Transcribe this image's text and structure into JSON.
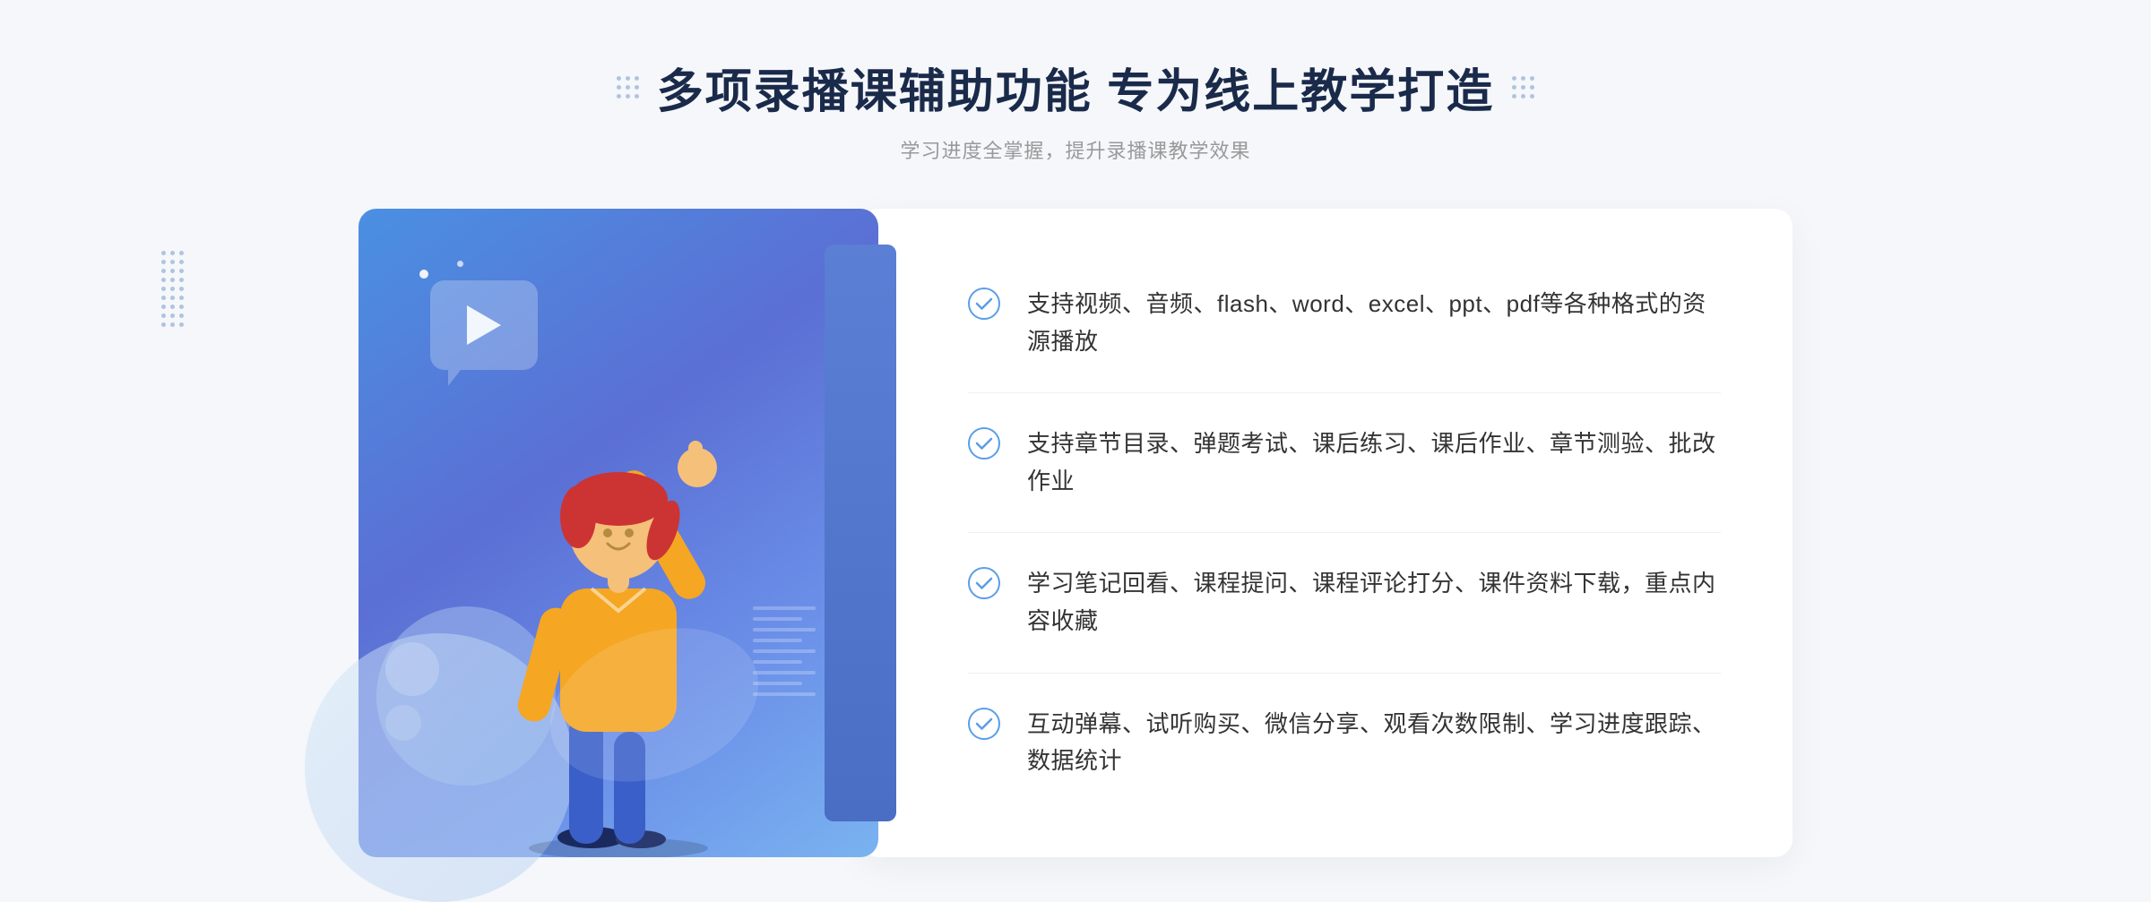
{
  "header": {
    "main_title": "多项录播课辅助功能 专为线上教学打造",
    "subtitle": "学习进度全掌握，提升录播课教学效果"
  },
  "features": [
    {
      "id": "feature-1",
      "text": "支持视频、音频、flash、word、excel、ppt、pdf等各种格式的资源播放"
    },
    {
      "id": "feature-2",
      "text": "支持章节目录、弹题考试、课后练习、课后作业、章节测验、批改作业"
    },
    {
      "id": "feature-3",
      "text": "学习笔记回看、课程提问、课程评论打分、课件资料下载，重点内容收藏"
    },
    {
      "id": "feature-4",
      "text": "互动弹幕、试听购买、微信分享、观看次数限制、学习进度跟踪、数据统计"
    }
  ],
  "colors": {
    "primary_blue": "#4a90e2",
    "dark_blue": "#1a2a4a",
    "text_gray": "#333333",
    "subtitle_gray": "#999999",
    "check_color": "#5b9ee8"
  },
  "decorations": {
    "left_chevron": "»",
    "sparkle_1": "·",
    "sparkle_2": "·"
  }
}
